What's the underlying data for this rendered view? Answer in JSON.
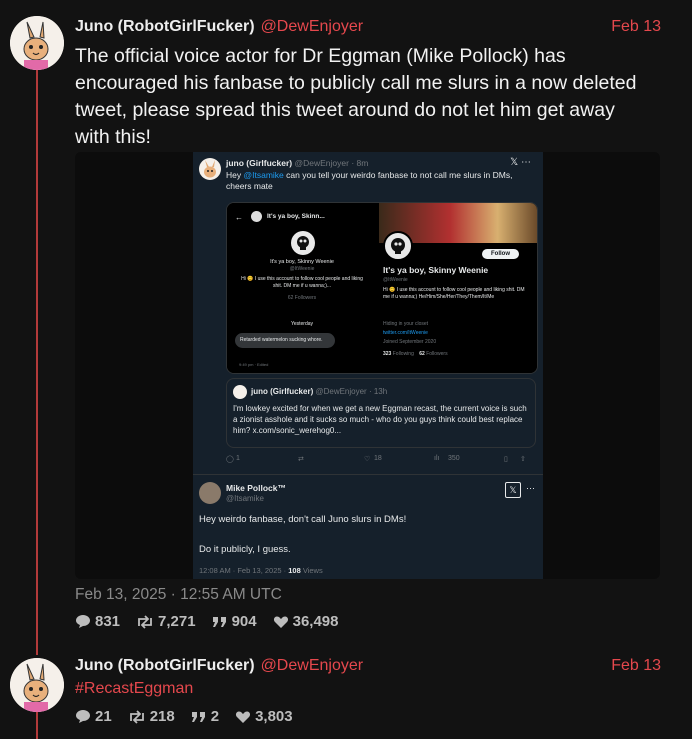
{
  "post1": {
    "author": "Juno (RobotGirlFucker)",
    "handle": "@DewEnjoyer",
    "date": "Feb 13",
    "text_lines": [
      "The official voice actor for Dr Eggman (Mike Pollock) has",
      "encouraged his fanbase to publicly call me slurs in a now deleted",
      "tweet, please spread this tweet around do not let him get away",
      "with this!"
    ],
    "timestamp": "Feb 13, 2025 · 12:55 AM UTC",
    "stats": {
      "comments": "831",
      "reposts": "7,271",
      "quotes": "904",
      "likes": "36,498"
    }
  },
  "embed": {
    "top_tweet": {
      "name": "juno (Girlfucker)",
      "handle_time": "@DewEnjoyer · 8m",
      "text_pre": "Hey",
      "mention": "@Itsamike",
      "text_post": "can you tell your weirdo fanbase to not call me slurs in DMs, cheers mate",
      "dm_screen": {
        "header": "It's ya boy, Skinn...",
        "name": "It's ya boy, Skinny Weenie",
        "handle": "@ItWeenie",
        "bio": "Hi 😊 I use this account to follow cool people and liking shit. DM me if u wanna;)...",
        "followers": "62 Followers",
        "divider": "Yesterday",
        "message": "Retarded watermelon sucking whore.",
        "msg_time": "9:49 pm · Edited"
      },
      "profile_screen": {
        "follow": "Follow",
        "name": "It's ya boy, Skinny Weenie",
        "handle": "@ItWeenie",
        "bio": "Hi 😊 I use this account to follow cool people and liking shit. DM me if u wanna;) He/Him/She/Her/They/Them/It/Me",
        "location": "Hiding in your closet",
        "link": "twitter.com/ItWeenie",
        "joined": "Joined September 2020",
        "following": "323",
        "following_label": "Following",
        "followers": "62",
        "followers_label": "Followers"
      },
      "quote": {
        "name": "juno (Girlfucker)",
        "handle_time": "@DewEnjoyer · 13h",
        "text": "I'm lowkey excited for when we get a new Eggman recast, the current voice is such a zionist asshole and it sucks so much - who do you guys think could best replace him? x.com/sonic_werehog0..."
      },
      "actions": {
        "replies": "1",
        "likes": "18",
        "views": "350"
      }
    },
    "reply": {
      "name": "Mike Pollock™",
      "handle": "@Itsamike",
      "line1": "Hey weirdo fanbase, don't call Juno slurs in DMs!",
      "line2": "Do it publicly, I guess.",
      "time": "12:08 AM · Feb 13, 2025 ·",
      "views": "108",
      "views_label": "Views"
    }
  },
  "post2": {
    "author": "Juno (RobotGirlFucker)",
    "handle": "@DewEnjoyer",
    "date": "Feb 13",
    "text": "#RecastEggman",
    "stats": {
      "comments": "21",
      "reposts": "218",
      "quotes": "2",
      "likes": "3,803"
    }
  },
  "colors": {
    "accent": "#e5484d",
    "background": "#121212",
    "twitter_dark": "#15202b",
    "twitter_blue": "#1d9bf0"
  }
}
